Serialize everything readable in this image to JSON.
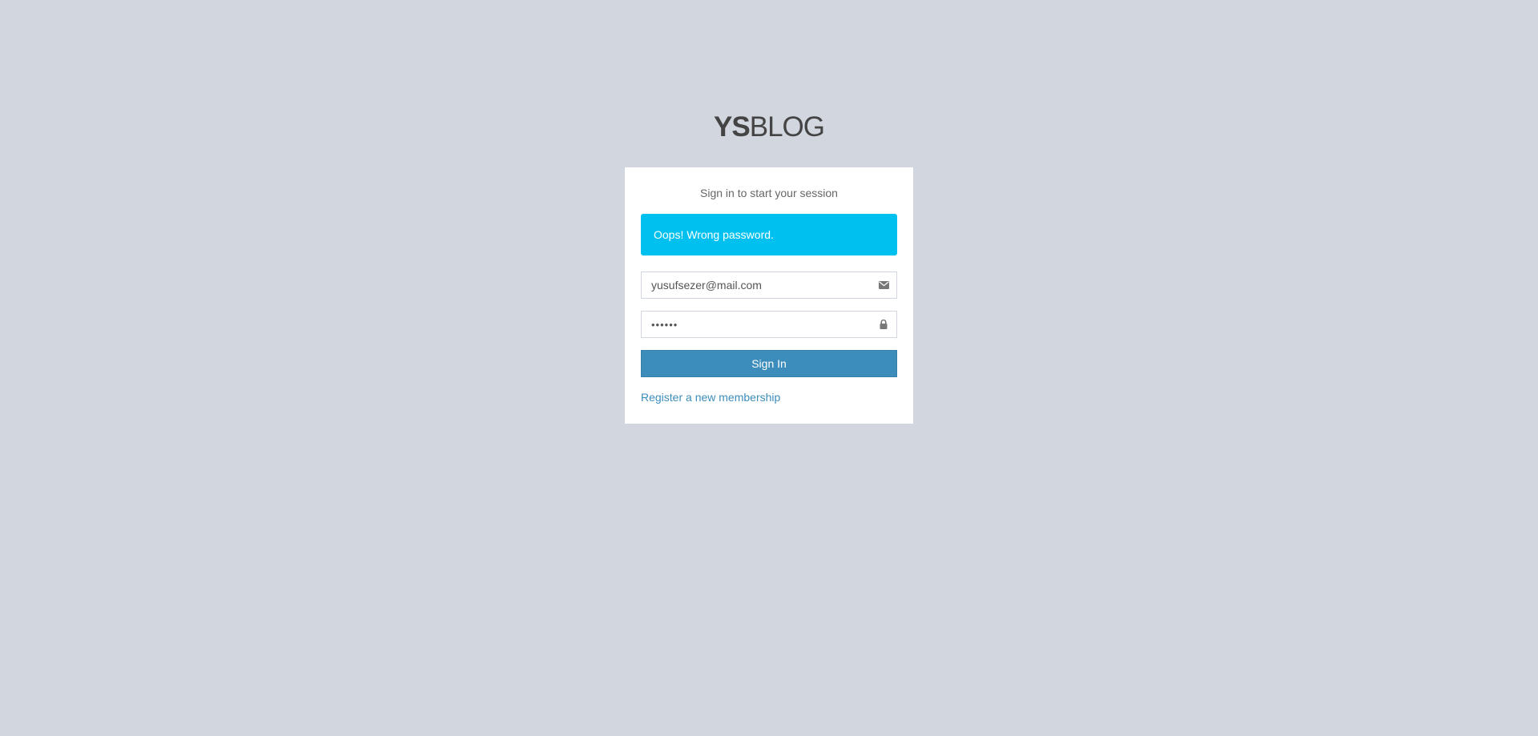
{
  "logo": {
    "bold": "YS",
    "light": "BLOG"
  },
  "login": {
    "message": "Sign in to start your session",
    "alert": "Oops! Wrong password.",
    "email_value": "yusufsezer@mail.com",
    "email_icon": "envelope-icon",
    "password_value": "••••••",
    "password_icon": "lock-icon",
    "sign_in_label": "Sign In",
    "register_link": "Register a new membership"
  },
  "colors": {
    "background": "#d2d6de",
    "alert": "#00c0ef",
    "primary": "#3c8dbc"
  }
}
